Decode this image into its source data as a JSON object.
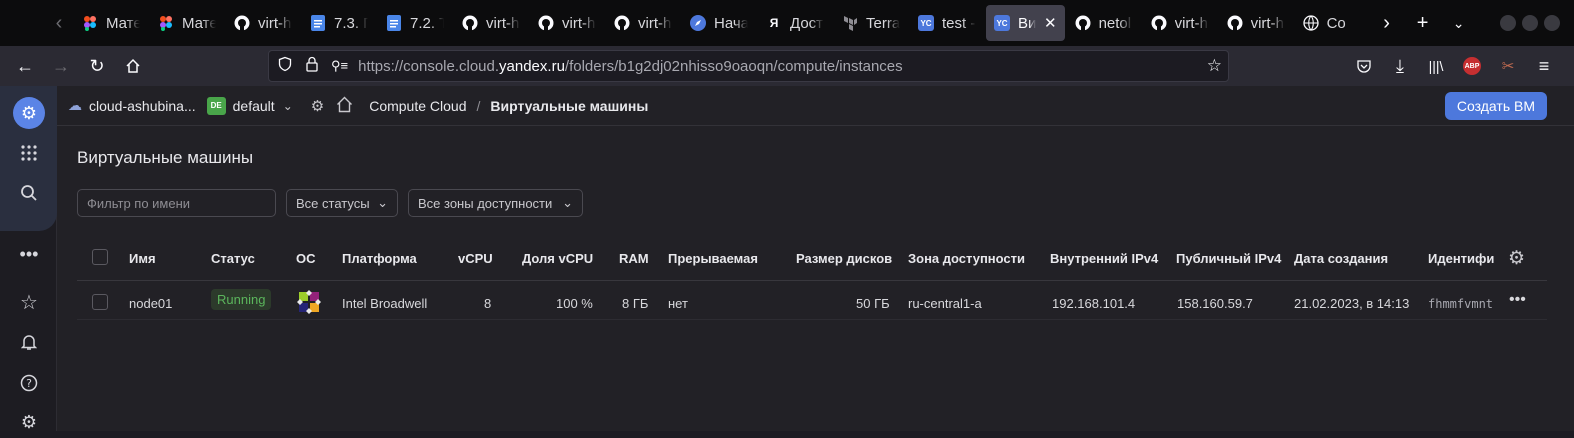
{
  "browser": {
    "tabs": [
      {
        "title": "Мате",
        "icon": "figma-icon"
      },
      {
        "title": "Мате",
        "icon": "figma-icon"
      },
      {
        "title": "virt-h",
        "icon": "github-icon"
      },
      {
        "title": "7.3. Г",
        "icon": "docs-icon"
      },
      {
        "title": "7.2. Т",
        "icon": "docs-icon"
      },
      {
        "title": "virt-h",
        "icon": "github-icon"
      },
      {
        "title": "virt-h",
        "icon": "github-icon"
      },
      {
        "title": "virt-h",
        "icon": "github-icon"
      },
      {
        "title": "Нача",
        "icon": "compass-icon"
      },
      {
        "title": "Дост",
        "icon": "yandex-icon"
      },
      {
        "title": "Terra",
        "icon": "terraform-icon"
      },
      {
        "title": "test -",
        "icon": "yc-icon"
      },
      {
        "title": "Ви",
        "icon": "yc-icon",
        "active": true
      },
      {
        "title": "netol",
        "icon": "github-icon"
      },
      {
        "title": "virt-h",
        "icon": "github-icon"
      },
      {
        "title": "virt-h",
        "icon": "github-icon"
      },
      {
        "title": "Со",
        "icon": "globe-icon"
      }
    ],
    "url": {
      "prefix": "https://console.cloud.",
      "domain": "yandex.ru",
      "path": "/folders/b1g2dj02nhisso9oaoqn/compute/instances"
    },
    "abp_label": "ABP"
  },
  "header": {
    "cloud": "cloud-ashubina...",
    "folder_badge": "DE",
    "folder": "default",
    "service": "Compute Cloud",
    "separator": "/",
    "current": "Виртуальные машины",
    "create_button": "Создать ВМ"
  },
  "page": {
    "title": "Виртуальные машины",
    "filter_placeholder": "Фильтр по имени",
    "status_select": "Все статусы",
    "zone_select": "Все зоны доступности"
  },
  "table": {
    "columns": [
      "Имя",
      "Статус",
      "ОС",
      "Платформа",
      "vCPU",
      "Доля vCPU",
      "RAM",
      "Прерываемая",
      "Размер дисков",
      "Зона доступности",
      "Внутренний IPv4",
      "Публичный IPv4",
      "Дата создания",
      "Идентифи"
    ],
    "rows": [
      {
        "name": "node01",
        "status": "Running",
        "os_icon": "centos-icon",
        "platform": "Intel Broadwell",
        "vcpu": "8",
        "vcpu_share": "100 %",
        "ram": "8 ГБ",
        "preemptible": "нет",
        "disk_size": "50 ГБ",
        "zone": "ru-central1-a",
        "internal_ip": "192.168.101.4",
        "public_ip": "158.160.59.7",
        "created": "21.02.2023, в 14:13",
        "id": "fhmmfvmnt"
      }
    ]
  },
  "colors": {
    "accent": "#4d78dc",
    "running": "#5bb55c"
  }
}
